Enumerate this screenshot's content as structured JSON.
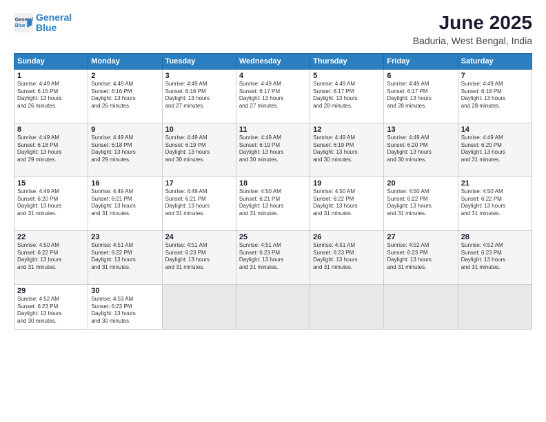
{
  "logo": {
    "line1": "General",
    "line2": "Blue"
  },
  "title": "June 2025",
  "subtitle": "Baduria, West Bengal, India",
  "weekdays": [
    "Sunday",
    "Monday",
    "Tuesday",
    "Wednesday",
    "Thursday",
    "Friday",
    "Saturday"
  ],
  "weeks": [
    [
      {
        "day": 1,
        "lines": [
          "Sunrise: 4:49 AM",
          "Sunset: 6:15 PM",
          "Daylight: 13 hours",
          "and 26 minutes."
        ]
      },
      {
        "day": 2,
        "lines": [
          "Sunrise: 4:49 AM",
          "Sunset: 6:16 PM",
          "Daylight: 13 hours",
          "and 26 minutes."
        ]
      },
      {
        "day": 3,
        "lines": [
          "Sunrise: 4:49 AM",
          "Sunset: 6:16 PM",
          "Daylight: 13 hours",
          "and 27 minutes."
        ]
      },
      {
        "day": 4,
        "lines": [
          "Sunrise: 4:49 AM",
          "Sunset: 6:17 PM",
          "Daylight: 13 hours",
          "and 27 minutes."
        ]
      },
      {
        "day": 5,
        "lines": [
          "Sunrise: 4:49 AM",
          "Sunset: 6:17 PM",
          "Daylight: 13 hours",
          "and 28 minutes."
        ]
      },
      {
        "day": 6,
        "lines": [
          "Sunrise: 4:49 AM",
          "Sunset: 6:17 PM",
          "Daylight: 13 hours",
          "and 28 minutes."
        ]
      },
      {
        "day": 7,
        "lines": [
          "Sunrise: 4:49 AM",
          "Sunset: 6:18 PM",
          "Daylight: 13 hours",
          "and 28 minutes."
        ]
      }
    ],
    [
      {
        "day": 8,
        "lines": [
          "Sunrise: 4:49 AM",
          "Sunset: 6:18 PM",
          "Daylight: 13 hours",
          "and 29 minutes."
        ]
      },
      {
        "day": 9,
        "lines": [
          "Sunrise: 4:49 AM",
          "Sunset: 6:18 PM",
          "Daylight: 13 hours",
          "and 29 minutes."
        ]
      },
      {
        "day": 10,
        "lines": [
          "Sunrise: 4:49 AM",
          "Sunset: 6:19 PM",
          "Daylight: 13 hours",
          "and 30 minutes."
        ]
      },
      {
        "day": 11,
        "lines": [
          "Sunrise: 4:49 AM",
          "Sunset: 6:19 PM",
          "Daylight: 13 hours",
          "and 30 minutes."
        ]
      },
      {
        "day": 12,
        "lines": [
          "Sunrise: 4:49 AM",
          "Sunset: 6:19 PM",
          "Daylight: 13 hours",
          "and 30 minutes."
        ]
      },
      {
        "day": 13,
        "lines": [
          "Sunrise: 4:49 AM",
          "Sunset: 6:20 PM",
          "Daylight: 13 hours",
          "and 30 minutes."
        ]
      },
      {
        "day": 14,
        "lines": [
          "Sunrise: 4:49 AM",
          "Sunset: 6:20 PM",
          "Daylight: 13 hours",
          "and 31 minutes."
        ]
      }
    ],
    [
      {
        "day": 15,
        "lines": [
          "Sunrise: 4:49 AM",
          "Sunset: 6:20 PM",
          "Daylight: 13 hours",
          "and 31 minutes."
        ]
      },
      {
        "day": 16,
        "lines": [
          "Sunrise: 4:49 AM",
          "Sunset: 6:21 PM",
          "Daylight: 13 hours",
          "and 31 minutes."
        ]
      },
      {
        "day": 17,
        "lines": [
          "Sunrise: 4:49 AM",
          "Sunset: 6:21 PM",
          "Daylight: 13 hours",
          "and 31 minutes."
        ]
      },
      {
        "day": 18,
        "lines": [
          "Sunrise: 4:50 AM",
          "Sunset: 6:21 PM",
          "Daylight: 13 hours",
          "and 31 minutes."
        ]
      },
      {
        "day": 19,
        "lines": [
          "Sunrise: 4:50 AM",
          "Sunset: 6:22 PM",
          "Daylight: 13 hours",
          "and 31 minutes."
        ]
      },
      {
        "day": 20,
        "lines": [
          "Sunrise: 4:50 AM",
          "Sunset: 6:22 PM",
          "Daylight: 13 hours",
          "and 31 minutes."
        ]
      },
      {
        "day": 21,
        "lines": [
          "Sunrise: 4:50 AM",
          "Sunset: 6:22 PM",
          "Daylight: 13 hours",
          "and 31 minutes."
        ]
      }
    ],
    [
      {
        "day": 22,
        "lines": [
          "Sunrise: 4:50 AM",
          "Sunset: 6:22 PM",
          "Daylight: 13 hours",
          "and 31 minutes."
        ]
      },
      {
        "day": 23,
        "lines": [
          "Sunrise: 4:51 AM",
          "Sunset: 6:22 PM",
          "Daylight: 13 hours",
          "and 31 minutes."
        ]
      },
      {
        "day": 24,
        "lines": [
          "Sunrise: 4:51 AM",
          "Sunset: 6:23 PM",
          "Daylight: 13 hours",
          "and 31 minutes."
        ]
      },
      {
        "day": 25,
        "lines": [
          "Sunrise: 4:51 AM",
          "Sunset: 6:23 PM",
          "Daylight: 13 hours",
          "and 31 minutes."
        ]
      },
      {
        "day": 26,
        "lines": [
          "Sunrise: 4:51 AM",
          "Sunset: 6:23 PM",
          "Daylight: 13 hours",
          "and 31 minutes."
        ]
      },
      {
        "day": 27,
        "lines": [
          "Sunrise: 4:52 AM",
          "Sunset: 6:23 PM",
          "Daylight: 13 hours",
          "and 31 minutes."
        ]
      },
      {
        "day": 28,
        "lines": [
          "Sunrise: 4:52 AM",
          "Sunset: 6:23 PM",
          "Daylight: 13 hours",
          "and 31 minutes."
        ]
      }
    ],
    [
      {
        "day": 29,
        "lines": [
          "Sunrise: 4:52 AM",
          "Sunset: 6:23 PM",
          "Daylight: 13 hours",
          "and 30 minutes."
        ]
      },
      {
        "day": 30,
        "lines": [
          "Sunrise: 4:53 AM",
          "Sunset: 6:23 PM",
          "Daylight: 13 hours",
          "and 30 minutes."
        ]
      },
      null,
      null,
      null,
      null,
      null
    ]
  ]
}
